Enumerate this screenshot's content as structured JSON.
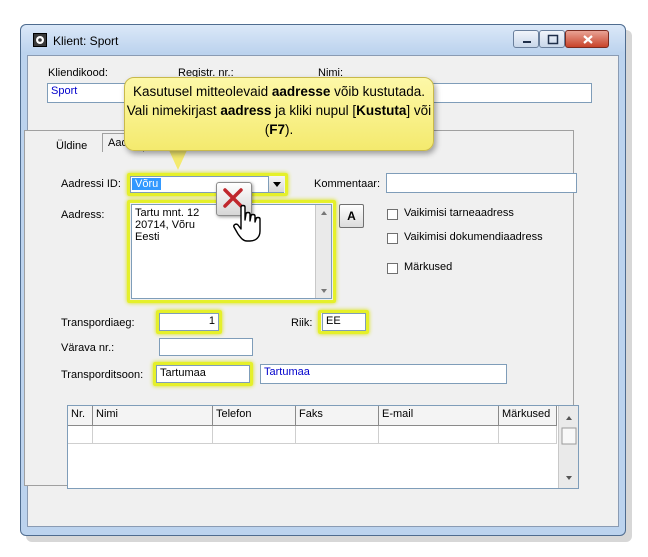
{
  "window": {
    "title": "Klient: Sport",
    "icon": "gear-app-icon"
  },
  "header": {
    "client_code_label": "Kliendikood:",
    "client_code_value": "Sport",
    "reg_no_label": "Registr. nr.:",
    "name_label": "Nimi:"
  },
  "tabs": [
    {
      "label": "Üldine"
    },
    {
      "label": "Aad"
    }
  ],
  "tooltip": {
    "part1": "Kasutusel mitteolevaid ",
    "part2": "aadresse",
    "part3": " võib kustutada. Vali nimekirjast ",
    "part4": "aadress",
    "part5": " ja kliki nupul [",
    "part6": "Kustuta",
    "part7": "] või (",
    "part8": "F7",
    "part9": ")."
  },
  "address": {
    "id_label": "Aadressi ID:",
    "id_value": "Võru",
    "comment_label": "Kommentaar:",
    "comment_value": "",
    "address_label": "Aadress:",
    "address_lines": [
      "Tartu mnt. 12",
      "20714, Võru",
      "Eesti"
    ],
    "a_button_label": "A",
    "checkbox_default_delivery": "Vaikimisi tarneaadress",
    "checkbox_default_document": "Vaikimisi dokumendiaadress",
    "checkbox_notes": "Märkused",
    "transport_days_label": "Transpordiaeg:",
    "transport_days_value": "1",
    "country_label": "Riik:",
    "country_value": "EE",
    "gate_label": "Värava nr.:",
    "gate_value": "",
    "transport_zone_label": "Transporditsoon:",
    "transport_zone_code": "Tartumaa",
    "transport_zone_name": "Tartumaa"
  },
  "contacts_table": {
    "columns": [
      "Nr.",
      "Nimi",
      "Telefon",
      "Faks",
      "E-mail",
      "Märkused"
    ]
  },
  "colors": {
    "highlight": "#e5f02a",
    "tooltip": "#f4ea6e",
    "link_blue": "#0000cc",
    "delete_red": "#c0272d"
  }
}
